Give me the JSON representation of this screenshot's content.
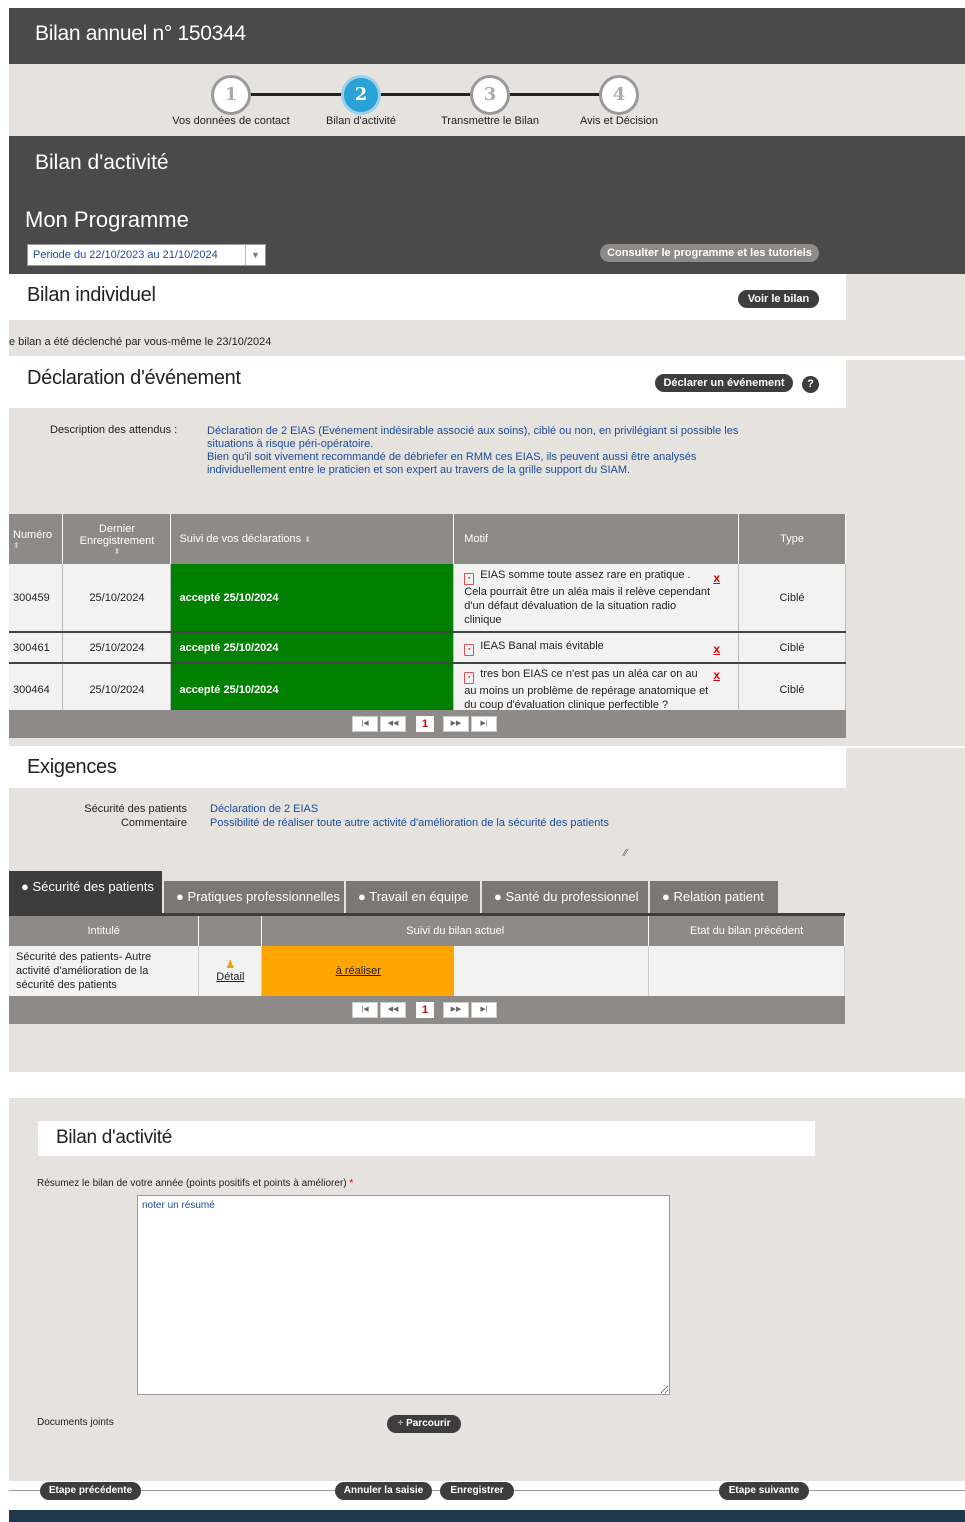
{
  "header": {
    "title": "Bilan annuel n° 150344"
  },
  "stepper": {
    "steps": [
      {
        "num": "1",
        "label": "Vos données de contact"
      },
      {
        "num": "2",
        "label": "Bilan d'activité"
      },
      {
        "num": "3",
        "label": "Transmettre le Bilan"
      },
      {
        "num": "4",
        "label": "Avis et Décision"
      }
    ],
    "active_step": "2"
  },
  "activity": {
    "title": "Bilan d'activité",
    "programme_title": "Mon Programme",
    "period_value": "Periode du 22/10/2023 au 21/10/2024",
    "programme_button": "Consulter le programme et les tutoriels"
  },
  "bilan_individuel": {
    "title": "Bilan individuel",
    "button": "Voir le bilan",
    "note": "e bilan a été déclenché par vous-même le 23/10/2024"
  },
  "declaration": {
    "title": "Déclaration d'événement",
    "button": "Déclarer un événement",
    "help": "?",
    "desc_label": "Description des attendus :",
    "desc_text": [
      "Déclaration de 2 EIAS (Evénement indésirable associé aux soins), ciblé ou non, en privilégiant si possible les",
      "situations à risque péri-opératoire.",
      "Bien qu'il soit vivement recommandé de débriefer en RMM ces EIAS, ils peuvent aussi être analysés",
      "individuellement entre le praticien et son expert au travers de la grille support du SIAM."
    ],
    "columns": [
      "Numéro",
      "Dernier Enregistrement",
      "Suivi de vos déclarations",
      "Motif",
      "Type"
    ],
    "rows": [
      {
        "num": "300459",
        "date": "25/10/2024",
        "status": "accepté 25/10/2024",
        "motif_first": "EIAS somme toute assez rare en pratique .",
        "motif_rest": [
          "Cela pourrait être un aléa mais il relève cependant",
          "d'un défaut dévaluation de la situation radio",
          "clinique"
        ],
        "type": "Ciblé"
      },
      {
        "num": "300461",
        "date": "25/10/2024",
        "status": "accepté 25/10/2024",
        "motif_first": "IEAS Banal mais évitable",
        "motif_rest": [],
        "type": "Ciblé"
      },
      {
        "num": "300464",
        "date": "25/10/2024",
        "status": "accepté 25/10/2024",
        "motif_first": "tres bon EIAS ce n'est pas un aléa car on au",
        "motif_rest": [
          "au moins un problème de repérage anatomique et",
          "du coup d'évaluation clinique perfectible ?"
        ],
        "type": "Ciblé"
      }
    ],
    "delete_mark": "x",
    "pager": {
      "page": "1"
    }
  },
  "exigences": {
    "title": "Exigences",
    "labels": [
      "Sécurité des patients",
      "Commentaire"
    ],
    "values": [
      "Déclaration de 2 EIAS",
      "Possibilité de réaliser toute autre activité d'amélioration de la sécurité des patients"
    ],
    "tabs": [
      "Sécurité des patients",
      "Pratiques professionnelles",
      "Travail en équipe",
      "Santé du professionnel",
      "Relation patient"
    ],
    "columns": [
      "Intitulé",
      "Suivi du bilan actuel",
      "Etat du bilan précédent"
    ],
    "row": {
      "intitule": [
        "Sécurité des patients- Autre",
        "activité d'amélioration de la",
        "sécurité des patients"
      ],
      "detail": "Détail",
      "suivi": "à réaliser"
    },
    "pager": {
      "page": "1"
    }
  },
  "summary": {
    "title": "Bilan d'activité",
    "prompt": "Résumez le bilan de votre année (points positifs et points à améliorer)",
    "required": "*",
    "textarea_value": "noter un résumé",
    "attachments_label": "Documents joints",
    "browse_button": "Parcourir"
  },
  "navigation": {
    "prev": "Etape précédente",
    "cancel": "Annuler la saisie",
    "save": "Enregistrer",
    "next": "Etape suivante"
  },
  "colors": {
    "accent_blue": "#2aa2d6",
    "accepted_green": "#008000",
    "todo_orange": "#ffa500",
    "dark_panel": "#4a4a4a"
  }
}
